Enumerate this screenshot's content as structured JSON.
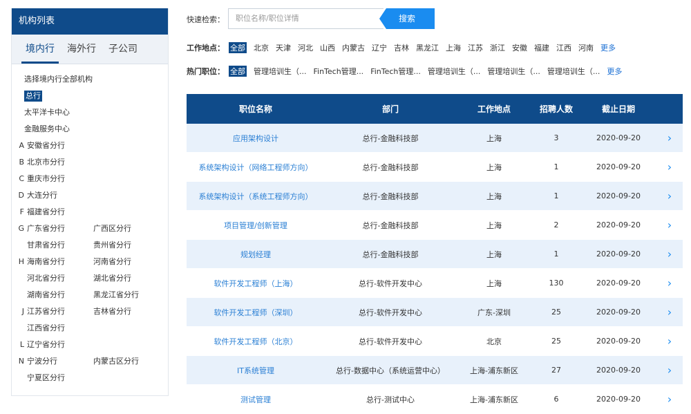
{
  "sidebar": {
    "title": "机构列表",
    "tabs": [
      "境内行",
      "海外行",
      "子公司"
    ],
    "select_all": "选择境内行全部机构",
    "plain_items": [
      "总行",
      "太平洋卡中心",
      "金融服务中心"
    ],
    "rows": [
      {
        "letter": "A",
        "c1": "安徽省分行",
        "c2": ""
      },
      {
        "letter": "B",
        "c1": "北京市分行",
        "c2": ""
      },
      {
        "letter": "C",
        "c1": "重庆市分行",
        "c2": ""
      },
      {
        "letter": "D",
        "c1": "大连分行",
        "c2": ""
      },
      {
        "letter": "F",
        "c1": "福建省分行",
        "c2": ""
      },
      {
        "letter": "G",
        "c1": "广东省分行",
        "c2": "广西区分行"
      },
      {
        "letter": "",
        "c1": "甘肃省分行",
        "c2": "贵州省分行"
      },
      {
        "letter": "H",
        "c1": "海南省分行",
        "c2": "河南省分行"
      },
      {
        "letter": "",
        "c1": "河北省分行",
        "c2": "湖北省分行"
      },
      {
        "letter": "",
        "c1": "湖南省分行",
        "c2": "黑龙江省分行"
      },
      {
        "letter": "J",
        "c1": "江苏省分行",
        "c2": "吉林省分行"
      },
      {
        "letter": "",
        "c1": "江西省分行",
        "c2": ""
      },
      {
        "letter": "L",
        "c1": "辽宁省分行",
        "c2": ""
      },
      {
        "letter": "N",
        "c1": "宁波分行",
        "c2": "内蒙古区分行"
      },
      {
        "letter": "",
        "c1": "宁夏区分行",
        "c2": ""
      }
    ]
  },
  "search": {
    "label": "快速检索：",
    "placeholder": "职位名称/职位详情",
    "button": "搜索"
  },
  "filters": {
    "location": {
      "label": "工作地点：",
      "items": [
        "全部",
        "北京",
        "天津",
        "河北",
        "山西",
        "内蒙古",
        "辽宁",
        "吉林",
        "黑龙江",
        "上海",
        "江苏",
        "浙江",
        "安徽",
        "福建",
        "江西",
        "河南"
      ],
      "more": "更多"
    },
    "position": {
      "label": "热门职位：",
      "items": [
        "全部",
        "管理培训生（...",
        "FinTech管理...",
        "FinTech管理...",
        "管理培训生（...",
        "管理培训生（...",
        "管理培训生（..."
      ],
      "more": "更多"
    }
  },
  "table": {
    "headers": [
      "职位名称",
      "部门",
      "工作地点",
      "招聘人数",
      "截止日期"
    ],
    "rows": [
      {
        "name": "应用架构设计",
        "dept": "总行-金融科技部",
        "loc": "上海",
        "count": "3",
        "date": "2020-09-20"
      },
      {
        "name": "系统架构设计（网络工程师方向）",
        "dept": "总行-金融科技部",
        "loc": "上海",
        "count": "1",
        "date": "2020-09-20"
      },
      {
        "name": "系统架构设计（系统工程师方向）",
        "dept": "总行-金融科技部",
        "loc": "上海",
        "count": "1",
        "date": "2020-09-20"
      },
      {
        "name": "项目管理/创新管理",
        "dept": "总行-金融科技部",
        "loc": "上海",
        "count": "2",
        "date": "2020-09-20"
      },
      {
        "name": "规划经理",
        "dept": "总行-金融科技部",
        "loc": "上海",
        "count": "1",
        "date": "2020-09-20"
      },
      {
        "name": "软件开发工程师（上海）",
        "dept": "总行-软件开发中心",
        "loc": "上海",
        "count": "130",
        "date": "2020-09-20"
      },
      {
        "name": "软件开发工程师（深圳）",
        "dept": "总行-软件开发中心",
        "loc": "广东-深圳",
        "count": "25",
        "date": "2020-09-20"
      },
      {
        "name": "软件开发工程师（北京）",
        "dept": "总行-软件开发中心",
        "loc": "北京",
        "count": "25",
        "date": "2020-09-20"
      },
      {
        "name": "IT系统管理",
        "dept": "总行-数据中心（系统运营中心）",
        "loc": "上海-浦东新区",
        "count": "27",
        "date": "2020-09-20"
      },
      {
        "name": "测试管理",
        "dept": "总行-测试中心",
        "loc": "上海-浦东新区",
        "count": "6",
        "date": "2020-09-20"
      }
    ],
    "arrow": "›"
  },
  "colors": {
    "primary": "#0f4b8a",
    "accent": "#1a8cf0",
    "row_alt": "#e8f1fb"
  }
}
